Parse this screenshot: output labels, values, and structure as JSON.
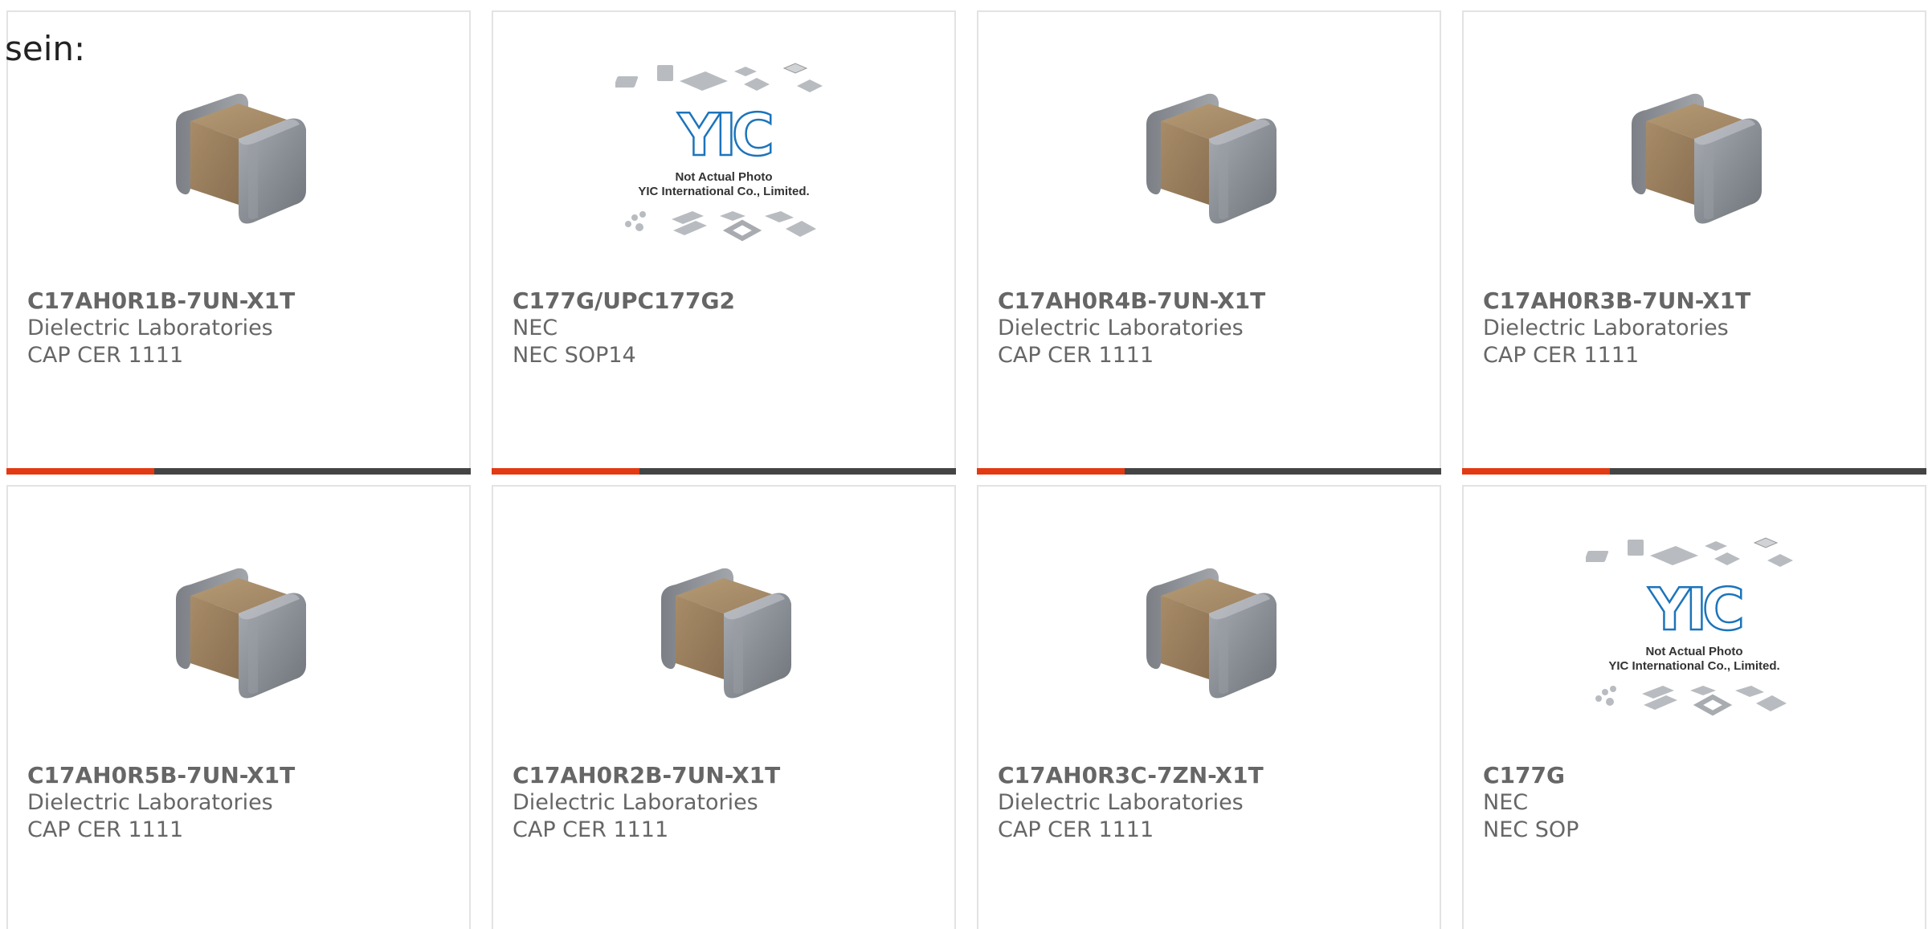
{
  "intro_text": "sein:",
  "colors": {
    "accent": "#e23a12",
    "bar": "#444444",
    "text": "#666666",
    "border": "#e3e3e3"
  },
  "products": [
    {
      "part_number": "C17AH0R1B-7UN-X1T",
      "manufacturer": "Dielectric Laboratories",
      "description": "CAP CER 1111",
      "image": "capacitor-chip",
      "show_bar": true
    },
    {
      "part_number": "C177G/UPC177G2",
      "manufacturer": "NEC",
      "description": "NEC SOP14",
      "image": "yic-placeholder",
      "placeholder_lines": [
        "Not Actual Photo",
        "YIC International Co., Limited."
      ],
      "logo_text": "YIC",
      "show_bar": true
    },
    {
      "part_number": "C17AH0R4B-7UN-X1T",
      "manufacturer": "Dielectric Laboratories",
      "description": "CAP CER 1111",
      "image": "capacitor-chip",
      "show_bar": true
    },
    {
      "part_number": "C17AH0R3B-7UN-X1T",
      "manufacturer": "Dielectric Laboratories",
      "description": "CAP CER 1111",
      "image": "capacitor-chip",
      "show_bar": true
    },
    {
      "part_number": "C17AH0R5B-7UN-X1T",
      "manufacturer": "Dielectric Laboratories",
      "description": "CAP CER 1111",
      "image": "capacitor-chip",
      "show_bar": false
    },
    {
      "part_number": "C17AH0R2B-7UN-X1T",
      "manufacturer": "Dielectric Laboratories",
      "description": "CAP CER 1111",
      "image": "capacitor-chip",
      "show_bar": false
    },
    {
      "part_number": "C17AH0R3C-7ZN-X1T",
      "manufacturer": "Dielectric Laboratories",
      "description": "CAP CER 1111",
      "image": "capacitor-chip",
      "show_bar": false
    },
    {
      "part_number": "C177G",
      "manufacturer": "NEC",
      "description": "NEC SOP",
      "image": "yic-placeholder",
      "placeholder_lines": [
        "Not Actual Photo",
        "YIC International Co., Limited."
      ],
      "logo_text": "YIC",
      "show_bar": false
    }
  ]
}
